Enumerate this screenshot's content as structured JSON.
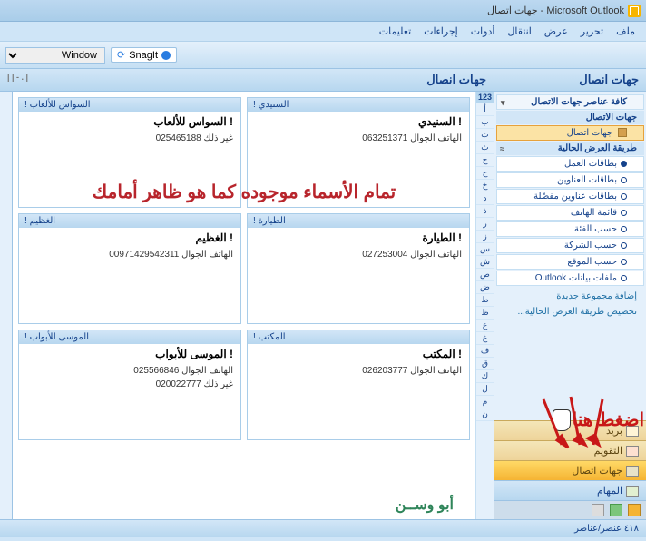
{
  "titlebar": {
    "title": "Microsoft Outlook - جهات اتصال"
  },
  "menu": {
    "file": "ملف",
    "edit": "تحرير",
    "view": "عرض",
    "go": "انتقال",
    "tools": "أدوات",
    "actions": "إجراءات",
    "help": "تعليمات"
  },
  "toolbar": {
    "snagit": "SnagIt",
    "window_select": "Window"
  },
  "sidebar": {
    "header": "جهات انصال",
    "all_items": "كافة عناصر جهات الاتصال",
    "groups": {
      "contacts_header": "جهات الاتصال",
      "contacts_item": "جهات اتصال",
      "view_header": "طريقة العرض الحالية",
      "views": [
        {
          "label": "بطاقات العمل",
          "selected": true
        },
        {
          "label": "بطاقات العناوين",
          "selected": false
        },
        {
          "label": "بطاقات عناوين مفصّلة",
          "selected": false
        },
        {
          "label": "قائمة الهاتف",
          "selected": false
        },
        {
          "label": "حسب الفئة",
          "selected": false
        },
        {
          "label": "حسب الشركة",
          "selected": false
        },
        {
          "label": "حسب الموقع",
          "selected": false
        },
        {
          "label": "ملفات بيانات Outlook",
          "selected": false
        }
      ]
    },
    "links": {
      "add_group": "إضافة مجموعة جديدة",
      "customize": "تخصيص طريقة العرض الحالية..."
    },
    "nav": {
      "mail": "بريد",
      "calendar": "التقويم",
      "contacts": "جهات اتصال",
      "tasks": "المهام"
    }
  },
  "content": {
    "header": "جهات انصال",
    "tools": "| . - | |",
    "alpha": [
      "123",
      "أ",
      "ب",
      "ت",
      "ث",
      "ج",
      "ح",
      "خ",
      "د",
      "ذ",
      "ر",
      "ز",
      "س",
      "ش",
      "ص",
      "ض",
      "ط",
      "ظ",
      "ع",
      "غ",
      "ف",
      "ق",
      "ك",
      "ل",
      "م",
      "ن"
    ],
    "cards": [
      {
        "head": "! السنيدي",
        "name": "! السنيدي",
        "line": "063251371 الهاتف الجوال"
      },
      {
        "head": "! السواس للألعاب",
        "name": "! السواس للألعاب",
        "line": "025465188 غير ذلك"
      },
      {
        "head": "! الطيارة",
        "name": "! الطيارة",
        "line": "027253004 الهاتف الجوال"
      },
      {
        "head": "! الغظيم",
        "name": "! الغظيم",
        "line": "00971429542311 الهاتف الجوال"
      },
      {
        "head": "! المكتب",
        "name": "! المكتب",
        "line": "026203777 الهاتف الجوال"
      },
      {
        "head": "! الموسى للأبواب",
        "name": "! الموسى للأبواب",
        "line1": "025566846 الهاتف الجوال",
        "line2": "020022777 غير ذلك"
      }
    ],
    "overlay": "تمام الأسماء موجوده كما هو ظاهر أمامك",
    "press_here": "اضغط هنا",
    "signature": "أبو وســن"
  },
  "status": {
    "text": "٤١٨ عنصر/عناصر"
  }
}
